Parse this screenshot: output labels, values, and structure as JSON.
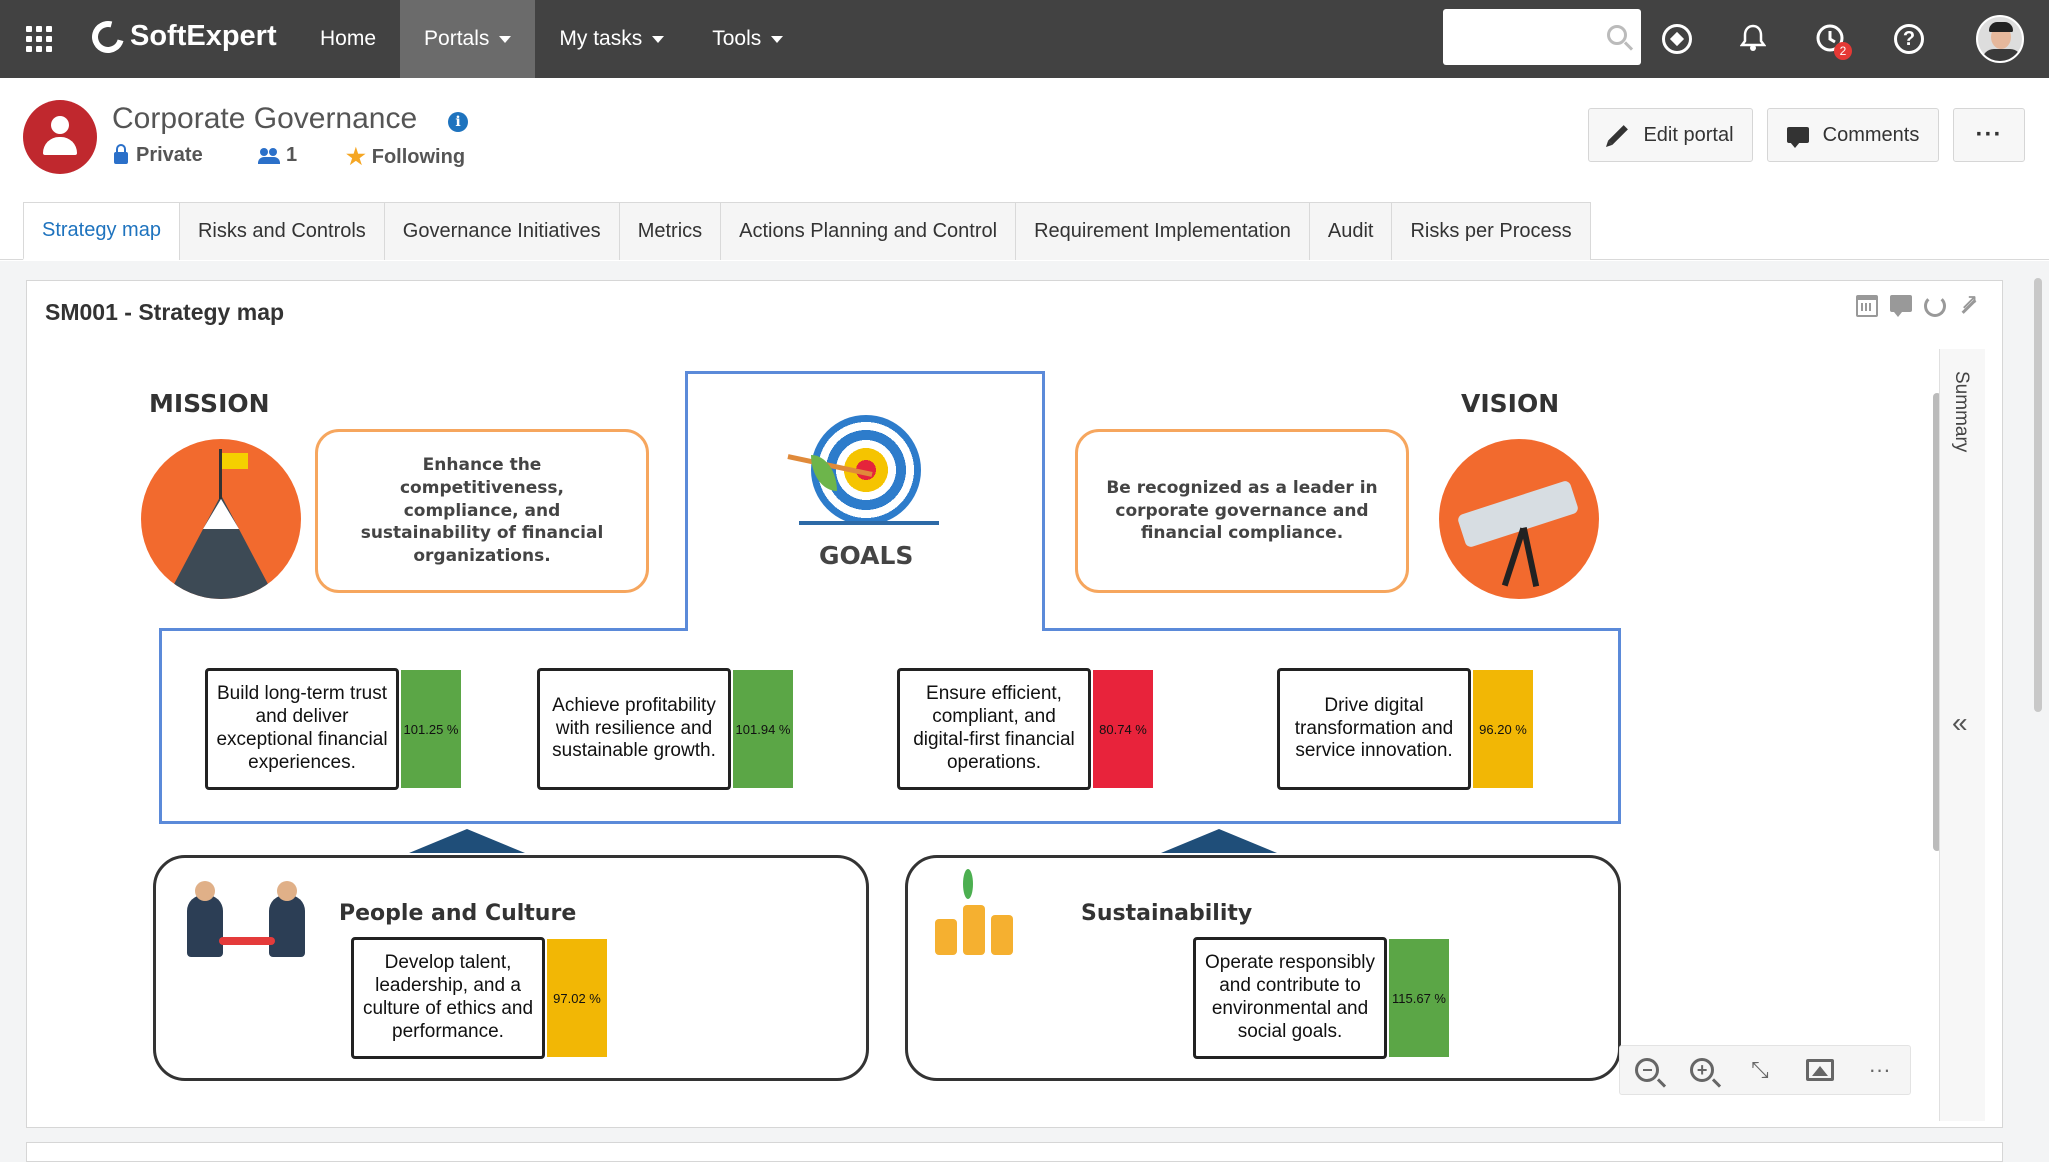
{
  "topbar": {
    "brand": "SoftExpert",
    "nav": [
      {
        "label": "Home",
        "has_caret": false,
        "active": false
      },
      {
        "label": "Portals",
        "has_caret": true,
        "active": true
      },
      {
        "label": "My tasks",
        "has_caret": true,
        "active": false
      },
      {
        "label": "Tools",
        "has_caret": true,
        "active": false
      }
    ],
    "search": {
      "placeholder": "",
      "value": ""
    },
    "notification_badge": "2"
  },
  "portal": {
    "title": "Corporate Governance",
    "privacy": "Private",
    "members": "1",
    "follow_status": "Following",
    "buttons": {
      "edit": "Edit portal",
      "comments": "Comments"
    }
  },
  "tabs": [
    {
      "label": "Strategy map",
      "active": true
    },
    {
      "label": "Risks and Controls",
      "active": false
    },
    {
      "label": "Governance Initiatives",
      "active": false
    },
    {
      "label": "Metrics",
      "active": false
    },
    {
      "label": "Actions Planning and Control",
      "active": false
    },
    {
      "label": "Requirement Implementation",
      "active": false
    },
    {
      "label": "Audit",
      "active": false
    },
    {
      "label": "Risks per Process",
      "active": false
    }
  ],
  "widget": {
    "title": "SM001 - Strategy map",
    "summary_label": "Summary"
  },
  "strategy_map": {
    "mission": {
      "heading": "MISSION",
      "text": "Enhance the competitiveness, compliance, and sustainability of financial organizations."
    },
    "vision": {
      "heading": "VISION",
      "text": "Be recognized as a leader in corporate governance and financial compliance."
    },
    "goals_heading": "GOALS",
    "goals": [
      {
        "text": "Build long-term trust and deliver exceptional financial experiences.",
        "value": "101.25 %",
        "status_color": "#5ba646"
      },
      {
        "text": "Achieve profitability with resilience and sustainable growth.",
        "value": "101.94 %",
        "status_color": "#5ba646"
      },
      {
        "text": "Ensure efficient, compliant, and digital-first financial operations.",
        "value": "80.74 %",
        "status_color": "#e8233b"
      },
      {
        "text": "Drive digital transformation and service innovation.",
        "value": "96.20 %",
        "status_color": "#f2b705"
      }
    ],
    "perspectives": [
      {
        "title": "People and Culture",
        "objective": {
          "text": "Develop talent, leadership, and a culture of ethics and performance.",
          "value": "97.02 %",
          "status_color": "#f2b705"
        }
      },
      {
        "title": "Sustainability",
        "objective": {
          "text": "Operate responsibly and contribute to environmental and social goals.",
          "value": "115.67 %",
          "status_color": "#5ba646"
        }
      }
    ]
  }
}
